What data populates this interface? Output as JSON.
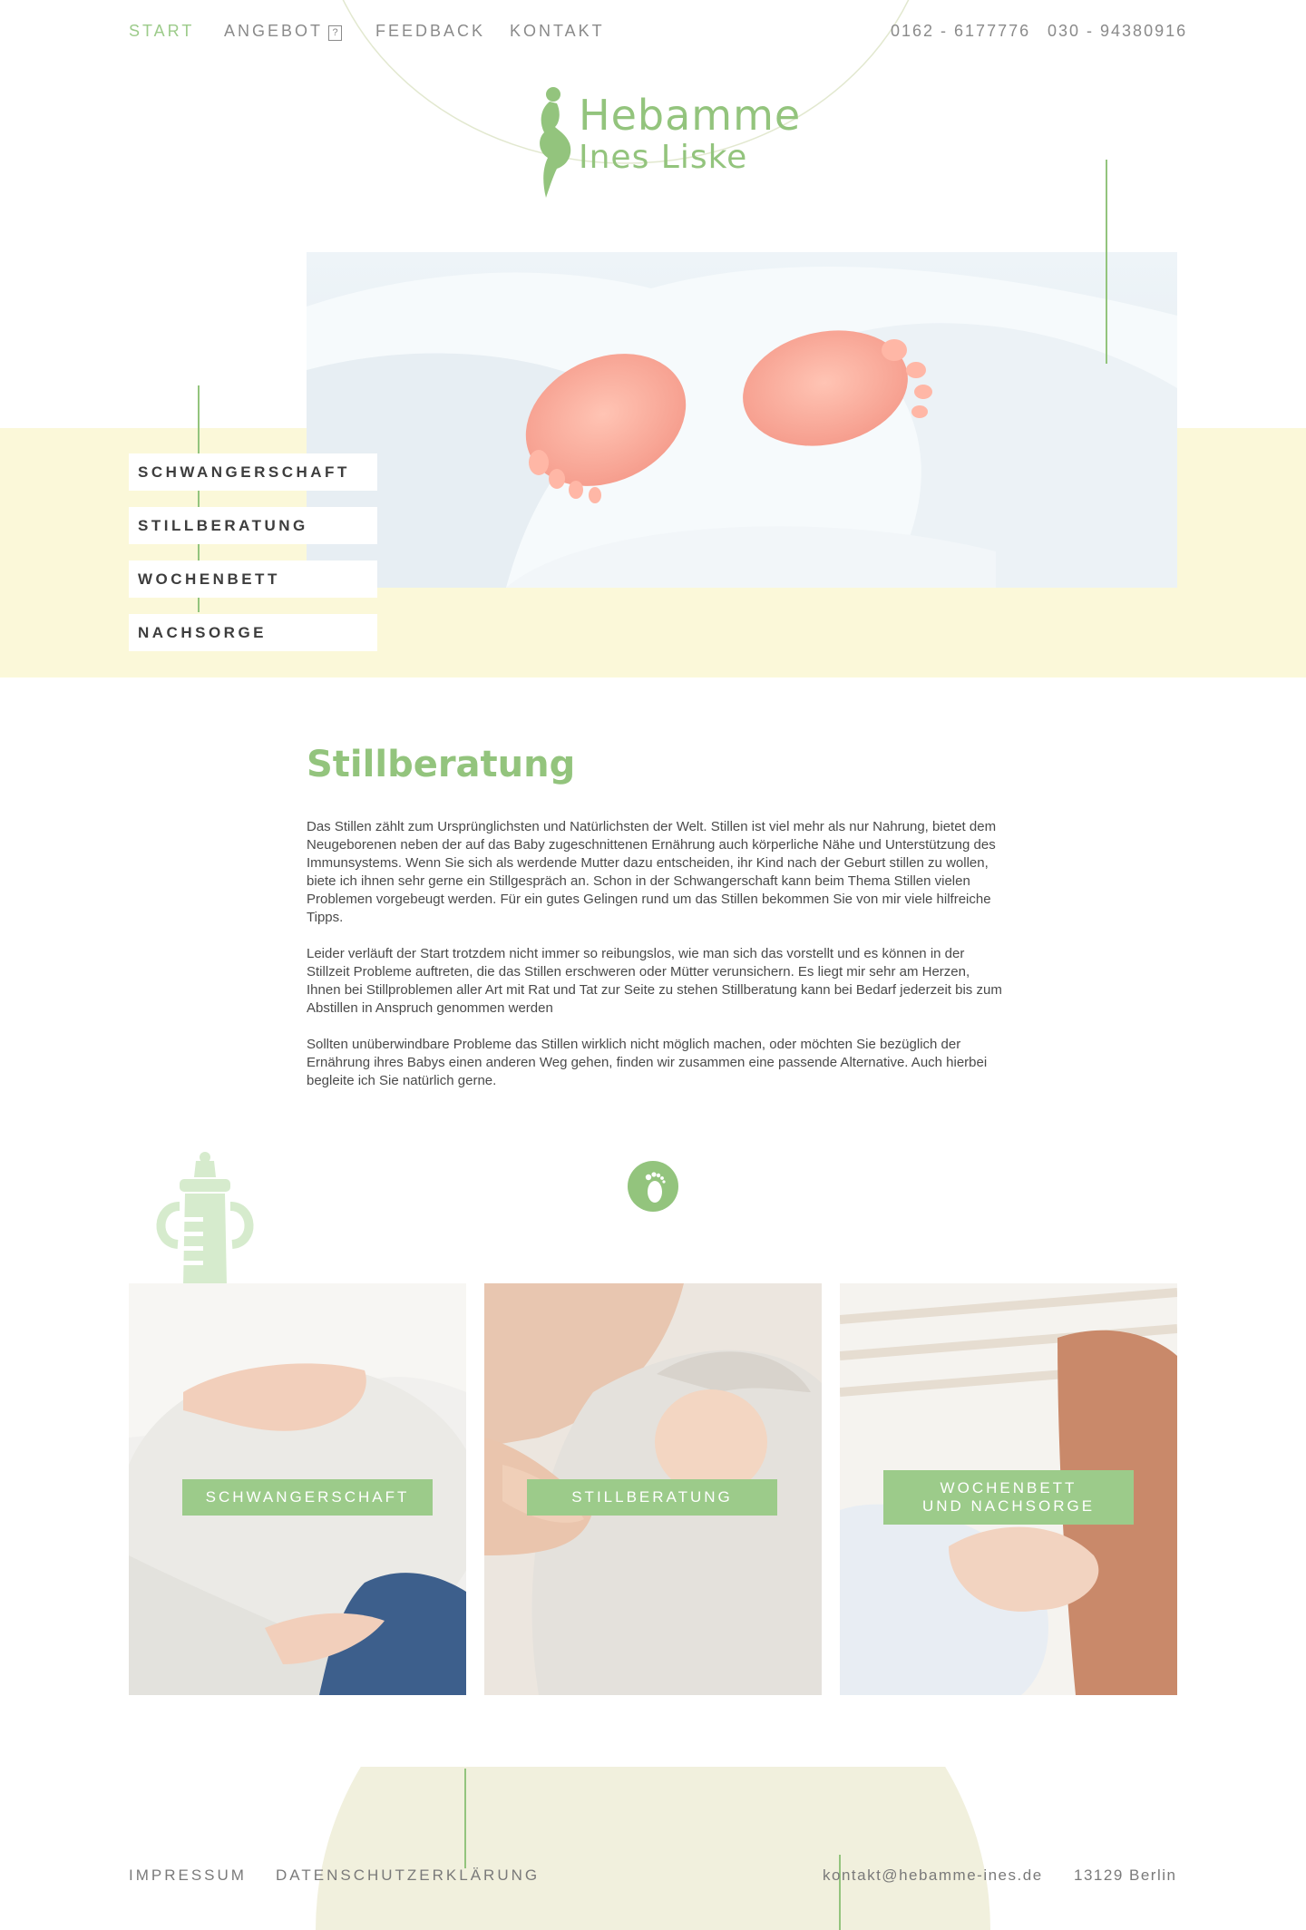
{
  "nav": {
    "start": "START",
    "angebot": "ANGEBOT",
    "angebot_marker": "?",
    "feedback": "FEEDBACK",
    "kontakt": "KONTAKT",
    "phone1": "0162 - 6177776",
    "phone2": "030 - 94380916"
  },
  "logo": {
    "title": "Hebamme",
    "subtitle": "Ines Liske"
  },
  "side_menu": {
    "items": [
      {
        "label": "SCHWANGERSCHAFT"
      },
      {
        "label": "STILLBERATUNG"
      },
      {
        "label": "WOCHENBETT"
      },
      {
        "label": "NACHSORGE"
      }
    ]
  },
  "content": {
    "title": "Stillberatung",
    "paragraphs": [
      "Das Stillen zählt zum Ursprünglichsten und Natürlichsten der Welt. Stillen ist viel mehr als nur Nahrung, bietet dem Neugeborenen neben der auf das Baby zugeschnittenen Ernährung auch körperliche Nähe und Unterstützung des Immunsystems. Wenn Sie sich als werdende Mutter dazu entscheiden, ihr Kind nach der Geburt stillen zu wollen, biete ich ihnen sehr gerne ein Stillgespräch an. Schon in der Schwangerschaft kann beim Thema Stillen vielen Problemen vorgebeugt werden. Für ein gutes Gelingen rund um das Stillen bekommen Sie von mir viele hilfreiche Tipps.",
      "Leider verläuft der Start trotzdem nicht immer so reibungslos, wie man sich das vorstellt und es können in der Stillzeit Probleme auftreten, die das Stillen erschweren oder Mütter verunsichern. Es liegt mir sehr am Herzen, Ihnen bei Stillproblemen aller Art mit Rat und Tat zur Seite zu stehen Stillberatung kann bei Bedarf jederzeit bis zum Abstillen in Anspruch genommen werden",
      "Sollten unüberwindbare Probleme das Stillen wirklich nicht möglich machen, oder möchten Sie bezüglich der Ernährung ihres Babys einen anderen Weg gehen, finden wir zusammen eine passende Alternative. Auch hierbei begleite ich Sie natürlich gerne."
    ]
  },
  "cards": [
    {
      "line1": "SCHWANGERSCHAFT",
      "line2": ""
    },
    {
      "line1": "STILLBERATUNG",
      "line2": ""
    },
    {
      "line1": "WOCHENBETT",
      "line2": "UND NACHSORGE"
    }
  ],
  "footer": {
    "impressum": "IMPRESSUM",
    "datenschutz": "DATENSCHUTZERKLÄRUNG",
    "email": "kontakt@hebamme-ines.de",
    "city": "13129 Berlin"
  },
  "colors": {
    "accent": "#93c47d",
    "button": "#9ccb8a",
    "band": "#fbf8d9",
    "footer_arc": "#f1f0dd"
  },
  "icons": {
    "logo": "pregnant-woman-silhouette-icon",
    "bottle": "baby-bottle-icon",
    "foot": "baby-foot-icon"
  }
}
